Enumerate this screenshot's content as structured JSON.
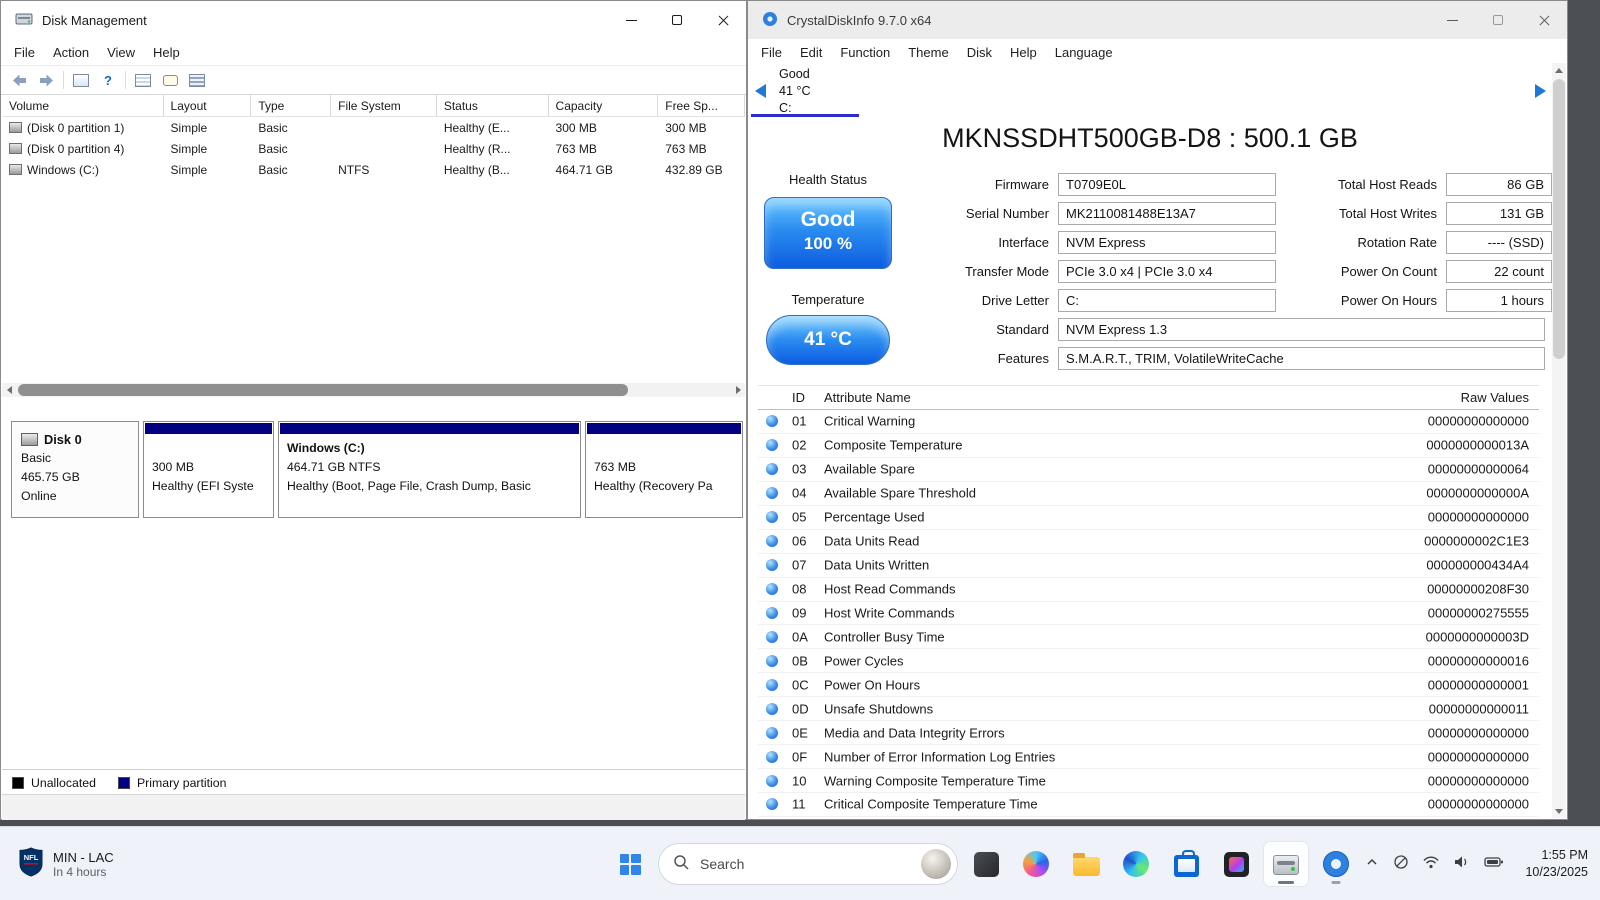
{
  "disk_management": {
    "title": "Disk Management",
    "menu": [
      "File",
      "Action",
      "View",
      "Help"
    ],
    "columns": [
      "Volume",
      "Layout",
      "Type",
      "File System",
      "Status",
      "Capacity",
      "Free Sp..."
    ],
    "volumes": [
      {
        "volume": "(Disk 0 partition 1)",
        "layout": "Simple",
        "type": "Basic",
        "file_system": "",
        "status": "Healthy (E...",
        "capacity": "300 MB",
        "free_space": "300 MB"
      },
      {
        "volume": "(Disk 0 partition 4)",
        "layout": "Simple",
        "type": "Basic",
        "file_system": "",
        "status": "Healthy (R...",
        "capacity": "763 MB",
        "free_space": "763 MB"
      },
      {
        "volume": "Windows (C:)",
        "layout": "Simple",
        "type": "Basic",
        "file_system": "NTFS",
        "status": "Healthy (B...",
        "capacity": "464.71 GB",
        "free_space": "432.89 GB"
      }
    ],
    "disk0": {
      "name": "Disk 0",
      "kind": "Basic",
      "size": "465.75 GB",
      "status": "Online"
    },
    "partitions": [
      {
        "title": "",
        "size": "300 MB",
        "status": "Healthy (EFI Syste"
      },
      {
        "title": "Windows  (C:)",
        "size": "464.71 GB NTFS",
        "status": "Healthy (Boot, Page File, Crash Dump, Basic"
      },
      {
        "title": "",
        "size": "763 MB",
        "status": "Healthy (Recovery Pa"
      }
    ],
    "legend": [
      {
        "label": "Unallocated",
        "color": "#000000"
      },
      {
        "label": "Primary partition",
        "color": "#000080"
      }
    ]
  },
  "crystaldiskinfo": {
    "title": "CrystalDiskInfo 9.7.0 x64",
    "menu": [
      "File",
      "Edit",
      "Function",
      "Theme",
      "Disk",
      "Help",
      "Language"
    ],
    "drive_tab": {
      "health": "Good",
      "temp": "41 °C",
      "letter": "C:"
    },
    "model": "MKNSSDHT500GB-D8 : 500.1 GB",
    "health": {
      "label": "Health Status",
      "status": "Good",
      "percent": "100 %"
    },
    "temperature": {
      "label": "Temperature",
      "value": "41 °C"
    },
    "fields_mid": [
      {
        "label": "Firmware",
        "value": "T0709E0L"
      },
      {
        "label": "Serial Number",
        "value": "MK2110081488E13A7"
      },
      {
        "label": "Interface",
        "value": "NVM Express"
      },
      {
        "label": "Transfer Mode",
        "value": "PCIe 3.0 x4 | PCIe 3.0 x4"
      },
      {
        "label": "Drive Letter",
        "value": "C:"
      },
      {
        "label": "Standard",
        "value": "NVM Express 1.3"
      },
      {
        "label": "Features",
        "value": "S.M.A.R.T., TRIM, VolatileWriteCache"
      }
    ],
    "fields_right": [
      {
        "label": "Total Host Reads",
        "value": "86 GB"
      },
      {
        "label": "Total Host Writes",
        "value": "131 GB"
      },
      {
        "label": "Rotation Rate",
        "value": "---- (SSD)"
      },
      {
        "label": "Power On Count",
        "value": "22 count"
      },
      {
        "label": "Power On Hours",
        "value": "1 hours"
      }
    ],
    "smart": {
      "headers": {
        "id": "ID",
        "name": "Attribute Name",
        "raw": "Raw Values"
      },
      "rows": [
        [
          "01",
          "Critical Warning",
          "00000000000000"
        ],
        [
          "02",
          "Composite Temperature",
          "0000000000013A"
        ],
        [
          "03",
          "Available Spare",
          "00000000000064"
        ],
        [
          "04",
          "Available Spare Threshold",
          "0000000000000A"
        ],
        [
          "05",
          "Percentage Used",
          "00000000000000"
        ],
        [
          "06",
          "Data Units Read",
          "0000000002C1E3"
        ],
        [
          "07",
          "Data Units Written",
          "000000000434A4"
        ],
        [
          "08",
          "Host Read Commands",
          "00000000208F30"
        ],
        [
          "09",
          "Host Write Commands",
          "00000000275555"
        ],
        [
          "0A",
          "Controller Busy Time",
          "0000000000003D"
        ],
        [
          "0B",
          "Power Cycles",
          "00000000000016"
        ],
        [
          "0C",
          "Power On Hours",
          "00000000000001"
        ],
        [
          "0D",
          "Unsafe Shutdowns",
          "00000000000011"
        ],
        [
          "0E",
          "Media and Data Integrity Errors",
          "00000000000000"
        ],
        [
          "0F",
          "Number of Error Information Log Entries",
          "00000000000000"
        ],
        [
          "10",
          "Warning Composite Temperature Time",
          "00000000000000"
        ],
        [
          "11",
          "Critical Composite Temperature Time",
          "00000000000000"
        ]
      ]
    }
  },
  "taskbar": {
    "widget": {
      "line1": "MIN - LAC",
      "line2": "In 4 hours"
    },
    "search_placeholder": "Search",
    "clock": {
      "time": "1:55 PM",
      "date": "10/23/2025"
    }
  }
}
